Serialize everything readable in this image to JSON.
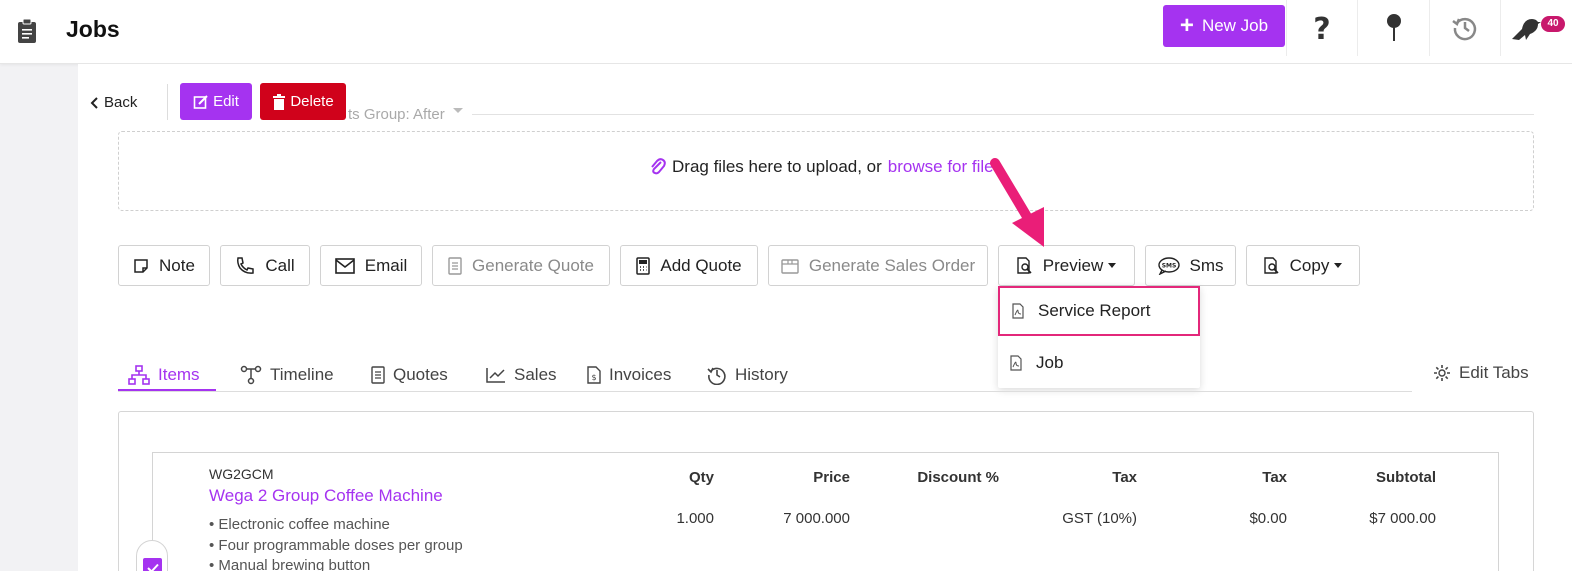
{
  "header": {
    "title": "Jobs",
    "new_job_label": "New Job",
    "notification_count": "40",
    "icons": [
      "clipboard-icon",
      "help-icon",
      "pin-icon",
      "history-icon",
      "bird-icon"
    ]
  },
  "toolbar": {
    "back_label": "Back",
    "edit_label": "Edit",
    "delete_label": "Delete"
  },
  "background_field": {
    "label": "ts Group: After"
  },
  "upload": {
    "text": "Drag files here to upload, or ",
    "link": "browse for files"
  },
  "actions": [
    {
      "label": "Note",
      "icon": "note-icon",
      "disabled": false
    },
    {
      "label": "Call",
      "icon": "phone-icon",
      "disabled": false
    },
    {
      "label": "Email",
      "icon": "envelope-icon",
      "disabled": false
    },
    {
      "label": "Generate Quote",
      "icon": "document-icon",
      "disabled": true
    },
    {
      "label": "Add Quote",
      "icon": "calculator-icon",
      "disabled": false
    },
    {
      "label": "Generate Sales Order",
      "icon": "box-icon",
      "disabled": true
    },
    {
      "label": "Preview",
      "icon": "preview-icon",
      "disabled": false
    },
    {
      "label": "Sms",
      "icon": "sms-icon",
      "disabled": false
    },
    {
      "label": "Copy",
      "icon": "copy-icon",
      "disabled": false
    }
  ],
  "preview_menu": {
    "items": [
      {
        "label": "Service Report",
        "icon": "pdf-icon"
      },
      {
        "label": "Job",
        "icon": "pdf-icon"
      }
    ]
  },
  "tabs": [
    {
      "label": "Items",
      "icon": "hierarchy-icon",
      "active": true
    },
    {
      "label": "Timeline",
      "icon": "timeline-icon",
      "active": false
    },
    {
      "label": "Quotes",
      "icon": "document-icon",
      "active": false
    },
    {
      "label": "Sales",
      "icon": "chart-line-icon",
      "active": false
    },
    {
      "label": "Invoices",
      "icon": "invoice-icon",
      "active": false
    },
    {
      "label": "History",
      "icon": "history-icon",
      "active": false
    }
  ],
  "edit_tabs_label": "Edit Tabs",
  "item": {
    "code": "WG2GCM",
    "name": "Wega 2 Group Coffee Machine",
    "bullets": [
      "• Electronic coffee machine",
      "• Four programmable doses per group",
      "• Manual brewing button"
    ],
    "columns": {
      "qty": "Qty",
      "price": "Price",
      "discount": "Discount %",
      "tax_code": "Tax",
      "tax_amount": "Tax",
      "subtotal": "Subtotal"
    },
    "values": {
      "qty": "1.000",
      "price": "7 000.000",
      "discount": "",
      "tax_code": "GST (10%)",
      "tax_amount": "$0.00",
      "subtotal": "$7 000.00"
    }
  },
  "colors": {
    "accent": "#a533f0",
    "danger": "#d0021b",
    "highlight": "#e3277a"
  }
}
